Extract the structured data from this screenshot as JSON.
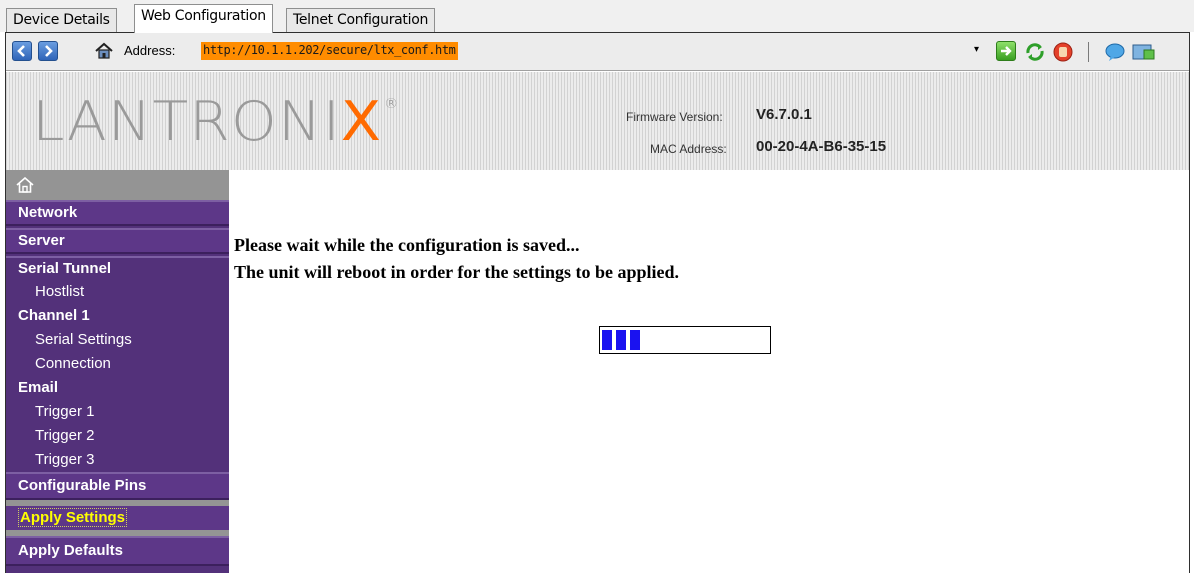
{
  "tabs": [
    "Device Details",
    "Web Configuration",
    "Telnet Configuration"
  ],
  "active_tab": "Web Configuration",
  "toolbar": {
    "back_icon": "back-arrow-icon",
    "forward_icon": "forward-arrow-icon",
    "home_icon": "home-icon",
    "address_label": "Address:",
    "address_value": "http://10.1.1.202/secure/ltx_conf.htm",
    "dropdown_icon": "dropdown-arrow-icon",
    "go_icon": "go-arrow-icon",
    "refresh_icon": "refresh-icon",
    "stop_icon": "stop-icon",
    "chat_icon": "speech-bubble-icon",
    "window_icon": "window-icon"
  },
  "header": {
    "logo_prefix": "LANTRONI",
    "logo_x": "X",
    "logo_reg": "®",
    "firmware_label": "Firmware Version:",
    "firmware_value": "V6.7.0.1",
    "mac_label": "MAC Address:",
    "mac_value": "00-20-4A-B6-35-15"
  },
  "sidebar": {
    "home_icon": "home-icon",
    "items": [
      {
        "label": "Network",
        "type": "section"
      },
      {
        "label": "Server",
        "type": "section"
      },
      {
        "label": "Serial Tunnel",
        "type": "section"
      },
      {
        "label": "Hostlist",
        "type": "sub"
      },
      {
        "label": "Channel 1",
        "type": "section"
      },
      {
        "label": "Serial Settings",
        "type": "sub"
      },
      {
        "label": "Connection",
        "type": "sub"
      },
      {
        "label": "Email",
        "type": "section"
      },
      {
        "label": "Trigger 1",
        "type": "sub"
      },
      {
        "label": "Trigger 2",
        "type": "sub"
      },
      {
        "label": "Trigger 3",
        "type": "sub"
      },
      {
        "label": "Configurable Pins",
        "type": "section"
      },
      {
        "label": "Apply Settings",
        "type": "section"
      },
      {
        "label": "Apply Defaults",
        "type": "section"
      }
    ]
  },
  "main": {
    "line1": "Please wait while the configuration is saved...",
    "line2": "The unit will reboot in order for the settings to be applied.",
    "progress": 0.25
  },
  "colors": {
    "sidebar": "#53317a",
    "address_highlight": "#ff8c00",
    "logo_x": "#ff6a00",
    "apply_text": "#ffff00",
    "progress_fill": "#1a12f0"
  }
}
